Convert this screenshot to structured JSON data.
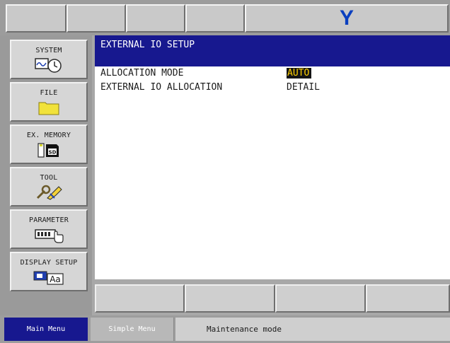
{
  "header": {
    "brand_letter": "Y"
  },
  "left_menu": [
    {
      "label": "SYSTEM",
      "icon": "system-icon"
    },
    {
      "label": "FILE",
      "icon": "folder-icon"
    },
    {
      "label": "EX. MEMORY",
      "icon": "sd-card-icon"
    },
    {
      "label": "TOOL",
      "icon": "tool-icon"
    },
    {
      "label": "PARAMETER",
      "icon": "parameter-hand-icon"
    },
    {
      "label": "DISPLAY SETUP",
      "icon": "display-setup-icon"
    }
  ],
  "screen": {
    "title": "EXTERNAL IO SETUP",
    "rows": [
      {
        "label": "ALLOCATION MODE",
        "value": "AUTO"
      },
      {
        "label": "EXTERNAL IO ALLOCATION",
        "value": "DETAIL"
      }
    ]
  },
  "status_bar": {
    "main_menu": "Main Menu",
    "simple_menu": "Simple Menu",
    "mode": "Maintenance mode"
  },
  "colors": {
    "title_bar": "#17188f",
    "highlight_bg": "#141414",
    "highlight_text": "#ffd000",
    "brand": "#0a3fbf"
  }
}
